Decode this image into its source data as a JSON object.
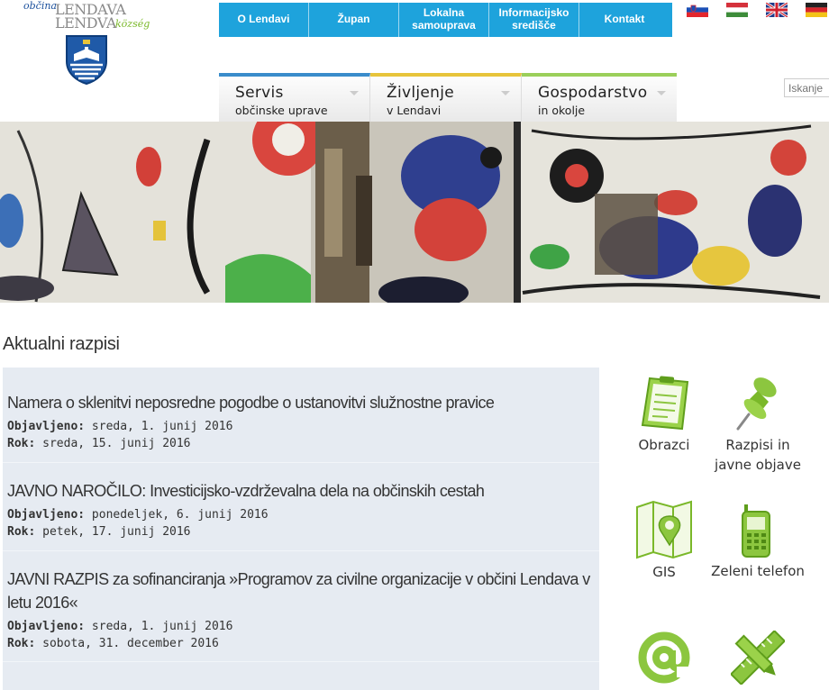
{
  "logo": {
    "obcina": "občina",
    "name1": "LENDAVA",
    "name2": "LENDVA",
    "kozseg": "község"
  },
  "topnav": [
    "O Lendavi",
    "Župan",
    "Lokalna samouprava",
    "Informacijsko središče",
    "Kontakt"
  ],
  "flags": [
    "slovenian-flag",
    "hungarian-flag",
    "uk-flag",
    "german-flag"
  ],
  "search": {
    "placeholder": "Iskanje"
  },
  "mainnav": [
    {
      "title": "Servis",
      "subtitle": "občinske uprave",
      "accent": "#3a8ccb"
    },
    {
      "title": "Življenje",
      "subtitle": "v Lendavi",
      "accent": "#e7c43b"
    },
    {
      "title": "Gospodarstvo",
      "subtitle": "in okolje",
      "accent": "#9bcf5a"
    }
  ],
  "section": {
    "title": "Aktualni razpisi"
  },
  "labels": {
    "published": "Objavljeno:",
    "deadline": "Rok:"
  },
  "entries": [
    {
      "title": "Namera o sklenitvi neposredne pogodbe o ustanovitvi služnostne pravice",
      "published": "sreda, 1. junij 2016",
      "deadline": "sreda, 15. junij 2016"
    },
    {
      "title": "JAVNO NAROČILO: Investicijsko-vzdrževalna dela na občinskih cestah",
      "published": "ponedeljek, 6. junij 2016",
      "deadline": "petek, 17. junij 2016"
    },
    {
      "title": "JAVNI RAZPIS za sofinanciranja »Programov za civilne organizacije v občini Lendava v letu 2016«",
      "published": "sreda, 1. junij 2016",
      "deadline": "sobota, 31. december 2016"
    }
  ],
  "quicklinks": [
    {
      "label": "Obrazci",
      "icon": "clipboard-icon"
    },
    {
      "label": "Razpisi in javne objave",
      "icon": "pushpin-icon"
    },
    {
      "label": "GIS",
      "icon": "map-icon"
    },
    {
      "label": "Zeleni telefon",
      "icon": "phone-icon"
    },
    {
      "label": "",
      "icon": "at-sign-icon"
    },
    {
      "label": "",
      "icon": "pencil-ruler-icon"
    }
  ],
  "colors": {
    "topnav": "#1ea3dc",
    "green": "#8cc63f",
    "list_bg": "#e6ebf2"
  }
}
